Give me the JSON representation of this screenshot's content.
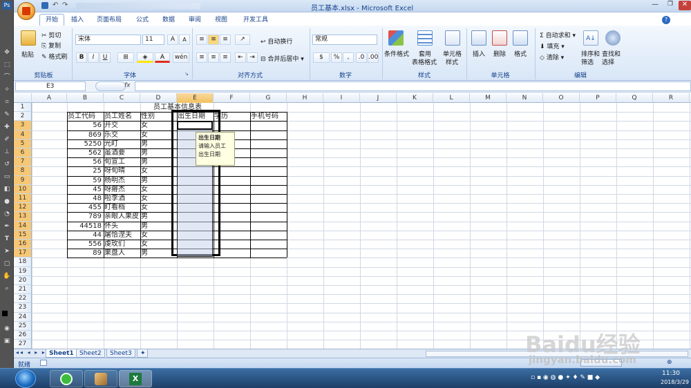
{
  "window": {
    "title": "员工基本.xlsx - Microsoft Excel"
  },
  "tabs": [
    "开始",
    "插入",
    "页面布局",
    "公式",
    "数据",
    "审阅",
    "视图",
    "开发工具"
  ],
  "ribbon": {
    "clipboard": {
      "paste": "粘贴",
      "cut": "剪切",
      "copy": "复制",
      "format_painter": "格式刷",
      "label": "剪贴板"
    },
    "font": {
      "name": "宋体",
      "size": "11",
      "bold": "B",
      "italic": "I",
      "underline": "U",
      "label": "字体"
    },
    "alignment": {
      "wrap": "自动换行",
      "merge": "合并后居中",
      "label": "对齐方式"
    },
    "number": {
      "format": "常规",
      "percent": "%",
      "comma": ",",
      "label": "数字"
    },
    "styles": {
      "conditional": "条件格式",
      "table": "套用\n表格格式",
      "table_a": "套用",
      "table_b": "表格格式",
      "cell": "单元格\n样式",
      "cell_a": "单元格",
      "cell_b": "样式",
      "label": "样式"
    },
    "cells": {
      "insert": "插入",
      "delete": "删除",
      "format": "格式",
      "label": "单元格"
    },
    "editing": {
      "autosum": "自动求和",
      "fill": "填充",
      "clear": "清除",
      "sort": "排序和\n筛选",
      "sort_a": "排序和",
      "sort_b": "筛选",
      "find": "查找和\n选择",
      "find_a": "查找和",
      "find_b": "选择",
      "label": "编辑"
    }
  },
  "formula_bar": {
    "name_box": "E3",
    "fx": "fx"
  },
  "columns": [
    "A",
    "B",
    "C",
    "D",
    "E",
    "F",
    "G",
    "H",
    "I",
    "J",
    "K",
    "L",
    "M",
    "N",
    "O",
    "P",
    "Q",
    "R"
  ],
  "rows": [
    "1",
    "2",
    "3",
    "4",
    "5",
    "6",
    "7",
    "8",
    "9",
    "10",
    "11",
    "12",
    "13",
    "14",
    "15",
    "16",
    "17",
    "18",
    "19",
    "20",
    "21",
    "22",
    "23",
    "24",
    "25",
    "26",
    "27"
  ],
  "sheet": {
    "title": "员工基本信息表",
    "headers": [
      "员工代码",
      "员工姓名",
      "性别",
      "出生日期",
      "学历",
      "手机号码"
    ],
    "records": [
      {
        "code": "56",
        "name": "开交",
        "sex": "女"
      },
      {
        "code": "869",
        "name": "乐交",
        "sex": "女"
      },
      {
        "code": "5250",
        "name": "光盯",
        "sex": "男"
      },
      {
        "code": "562",
        "name": "虽酒要",
        "sex": "男"
      },
      {
        "code": "56",
        "name": "旬宣工",
        "sex": "男"
      },
      {
        "code": "25",
        "name": "呀旬晴",
        "sex": "女"
      },
      {
        "code": "59",
        "name": "杨明杰",
        "sex": "男"
      },
      {
        "code": "45",
        "name": "呀瘠杰",
        "sex": "女"
      },
      {
        "code": "48",
        "name": "啦李洒",
        "sex": "女"
      },
      {
        "code": "455",
        "name": "盯看档",
        "sex": "女"
      },
      {
        "code": "789",
        "name": "亲眼人果皮",
        "sex": "男"
      },
      {
        "code": "44518",
        "name": "怀头",
        "sex": "男"
      },
      {
        "code": "44",
        "name": "屠恰涅夫",
        "sex": "女"
      },
      {
        "code": "556",
        "name": "虔玫们",
        "sex": "女"
      },
      {
        "code": "89",
        "name": "果盘人",
        "sex": "男"
      }
    ]
  },
  "tooltip": {
    "title": "出生日期",
    "line1": "请输入员工",
    "line2": "出生日期"
  },
  "sheet_tabs": [
    "Sheet1",
    "Sheet2",
    "Sheet3"
  ],
  "status": {
    "ready": "就绪"
  },
  "taskbar": {
    "time": "11:30",
    "date": "2018/3/29"
  },
  "watermark": {
    "brand": "Baidu经验",
    "url": "jingyan.baidu.com"
  }
}
